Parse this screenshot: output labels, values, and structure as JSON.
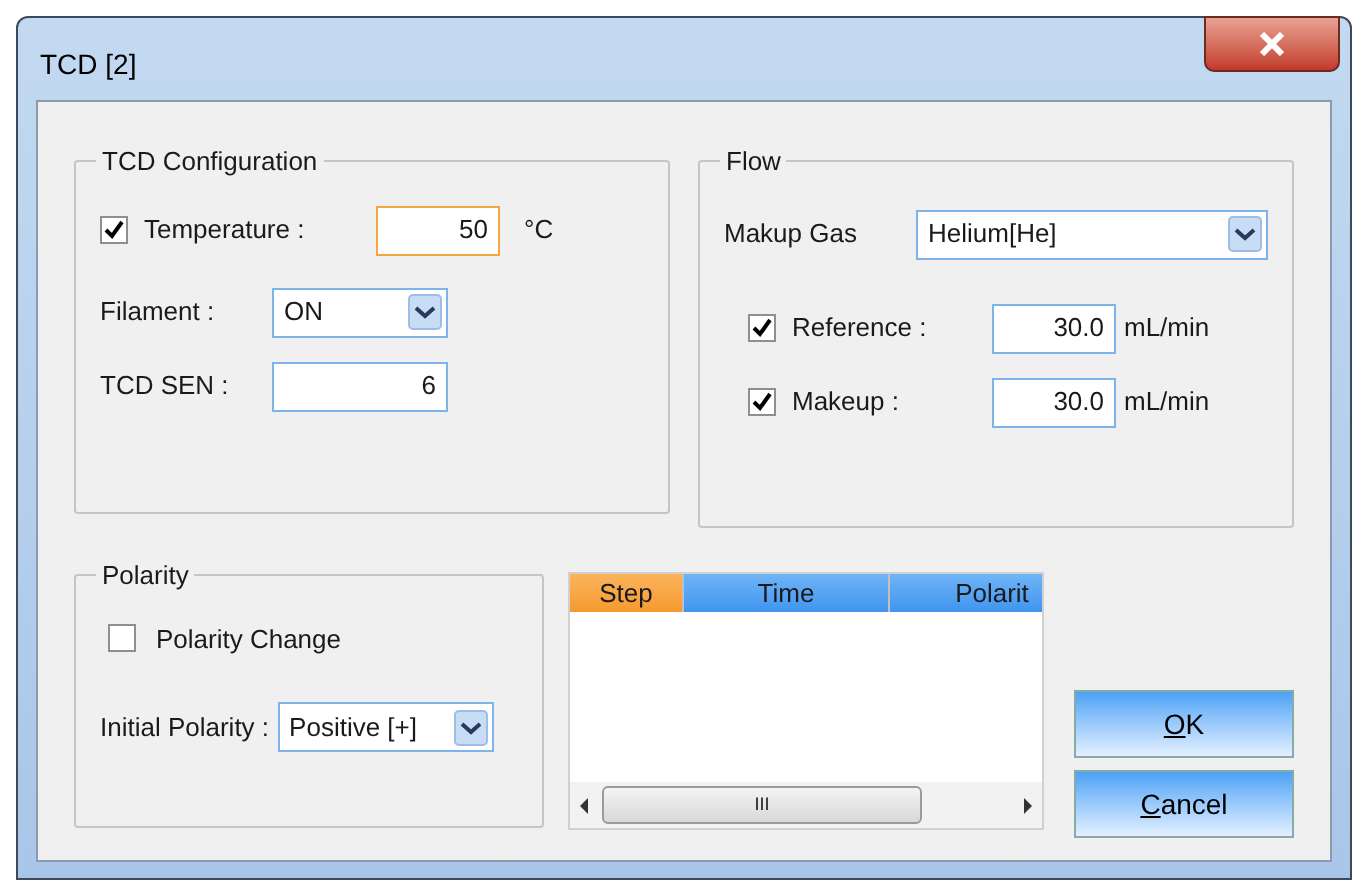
{
  "window": {
    "title": "TCD [2]"
  },
  "tcd_configuration": {
    "title": "TCD Configuration",
    "temperature": {
      "checked": true,
      "label": "Temperature :",
      "value": "50",
      "unit": "°C",
      "focused": true
    },
    "filament": {
      "label": "Filament :",
      "value": "ON"
    },
    "tcd_sen": {
      "label": "TCD SEN :",
      "value": "6"
    }
  },
  "flow": {
    "title": "Flow",
    "makeup_gas": {
      "label": "Makup Gas",
      "value": "Helium[He]"
    },
    "rows": [
      {
        "checked": true,
        "label": "Reference :",
        "value": "30.0",
        "unit": "mL/min"
      },
      {
        "checked": true,
        "label": "Makeup :",
        "value": "30.0",
        "unit": "mL/min"
      }
    ]
  },
  "polarity": {
    "title": "Polarity",
    "polarity_change": {
      "checked": false,
      "label": "Polarity Change"
    },
    "initial_polarity": {
      "label": "Initial Polarity :",
      "value": "Positive [+]"
    }
  },
  "table": {
    "columns": [
      {
        "label": "Step",
        "selected": true
      },
      {
        "label": "Time",
        "selected": false
      },
      {
        "label": "Polarit",
        "selected": false
      }
    ],
    "scroll_thumb": "III"
  },
  "buttons": [
    {
      "accel": "O",
      "rest": "K"
    },
    {
      "accel": "C",
      "rest": "ancel"
    }
  ]
}
